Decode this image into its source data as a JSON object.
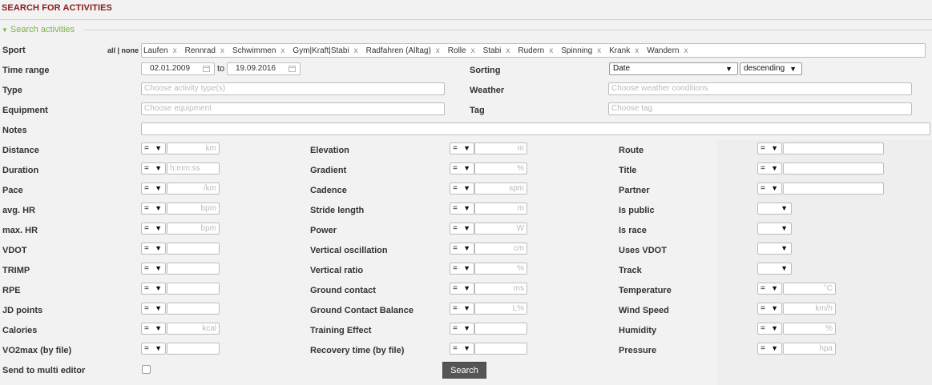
{
  "page": {
    "title": "SEARCH FOR ACTIVITIES",
    "legend": "Search activities"
  },
  "sport": {
    "label": "Sport",
    "all_none": "all | none",
    "chips": [
      "Laufen",
      "Rennrad",
      "Schwimmen",
      "Gym|Kraft|Stabi",
      "Radfahren (Alltag)",
      "Rolle",
      "Stabi",
      "Rudern",
      "Spinning",
      "Krank",
      "Wandern"
    ],
    "remove_glyph": "x"
  },
  "time_range": {
    "label": "Time range",
    "from": "02.01.2009",
    "to_label": "to",
    "to": "19.09.2016"
  },
  "sorting": {
    "label": "Sorting",
    "field": "Date",
    "order": "descending"
  },
  "type": {
    "label": "Type",
    "placeholder": "Choose activity type(s)"
  },
  "weather": {
    "label": "Weather",
    "placeholder": "Choose weather conditions"
  },
  "equipment": {
    "label": "Equipment",
    "placeholder": "Choose equipment"
  },
  "tag": {
    "label": "Tag",
    "placeholder": "Choose tag"
  },
  "notes": {
    "label": "Notes"
  },
  "operator": "=",
  "dropdown_glyph": "▼",
  "col1": [
    {
      "label": "Distance",
      "unit": "km"
    },
    {
      "label": "Duration",
      "unit": "h:mm:ss"
    },
    {
      "label": "Pace",
      "unit": "/km"
    },
    {
      "label": "avg. HR",
      "unit": "bpm"
    },
    {
      "label": "max. HR",
      "unit": "bpm"
    },
    {
      "label": "VDOT",
      "unit": ""
    },
    {
      "label": "TRIMP",
      "unit": ""
    },
    {
      "label": "RPE",
      "unit": ""
    },
    {
      "label": "JD points",
      "unit": ""
    },
    {
      "label": "Calories",
      "unit": "kcal"
    },
    {
      "label": "VO2max (by file)",
      "unit": ""
    }
  ],
  "col2": [
    {
      "label": "Elevation",
      "unit": "m"
    },
    {
      "label": "Gradient",
      "unit": "%"
    },
    {
      "label": "Cadence",
      "unit": "spm"
    },
    {
      "label": "Stride length",
      "unit": "m"
    },
    {
      "label": "Power",
      "unit": "W"
    },
    {
      "label": "Vertical oscillation",
      "unit": "cm"
    },
    {
      "label": "Vertical ratio",
      "unit": "%"
    },
    {
      "label": "Ground contact",
      "unit": "ms"
    },
    {
      "label": "Ground Contact Balance",
      "unit": "L%"
    },
    {
      "label": "Training Effect",
      "unit": ""
    },
    {
      "label": "Recovery time (by file)",
      "unit": ""
    }
  ],
  "col3": [
    {
      "label": "Route",
      "kind": "text",
      "unit": ""
    },
    {
      "label": "Title",
      "kind": "text",
      "unit": ""
    },
    {
      "label": "Partner",
      "kind": "text",
      "unit": ""
    },
    {
      "label": "Is public",
      "kind": "bool",
      "unit": ""
    },
    {
      "label": "Is race",
      "kind": "bool",
      "unit": ""
    },
    {
      "label": "Uses VDOT",
      "kind": "bool",
      "unit": ""
    },
    {
      "label": "Track",
      "kind": "bool",
      "unit": ""
    },
    {
      "label": "Temperature",
      "kind": "num",
      "unit": "°C"
    },
    {
      "label": "Wind Speed",
      "kind": "num",
      "unit": "km/h"
    },
    {
      "label": "Humidity",
      "kind": "num",
      "unit": "%"
    },
    {
      "label": "Pressure",
      "kind": "num",
      "unit": "hpa"
    }
  ],
  "multi_editor": {
    "label": "Send to multi editor"
  },
  "search_button": "Search",
  "colors": {
    "title": "#8b1a1a",
    "legend": "#7db34a",
    "button": "#555555"
  }
}
